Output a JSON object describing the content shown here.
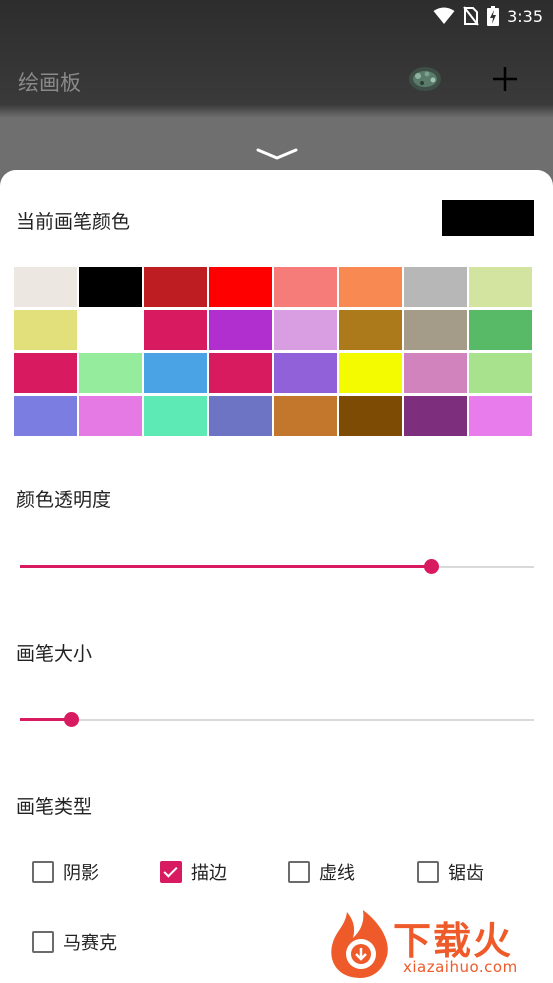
{
  "status_bar": {
    "time": "3:35"
  },
  "app_bar": {
    "title": "绘画板"
  },
  "sheet": {
    "current_color_label": "当前画笔颜色",
    "current_color": "#000000",
    "palette": [
      "#ede7e1",
      "#000000",
      "#be1e22",
      "#ff0000",
      "#f67c7a",
      "#f98952",
      "#b7b7b7",
      "#d3e4a1",
      "#e2e07a",
      "#ffffff",
      "#d81b60",
      "#b02fce",
      "#d99de2",
      "#ac7a1b",
      "#a49c88",
      "#58b967",
      "#d81b60",
      "#96ec9d",
      "#4aa3e4",
      "#d81b5e",
      "#9161da",
      "#f4fb00",
      "#d183be",
      "#a9e28c",
      "#7c7de0",
      "#e67ae5",
      "#5eeab4",
      "#6d74c3",
      "#c2772d",
      "#7d4b04",
      "#7d2e7d",
      "#e97cec"
    ],
    "opacity_label": "颜色透明度",
    "opacity_value": 0.8,
    "size_label": "画笔大小",
    "size_value": 0.1,
    "brush_type_label": "画笔类型",
    "brush_types": [
      {
        "label": "阴影",
        "checked": false
      },
      {
        "label": "描边",
        "checked": true
      },
      {
        "label": "虚线",
        "checked": false
      },
      {
        "label": "锯齿",
        "checked": false
      },
      {
        "label": "马赛克",
        "checked": false
      }
    ]
  },
  "watermark": {
    "name": "下载火",
    "url": "xiazaihuo.com"
  },
  "colors": {
    "accent": "#d81b60",
    "watermark": "#ee5a2a"
  }
}
